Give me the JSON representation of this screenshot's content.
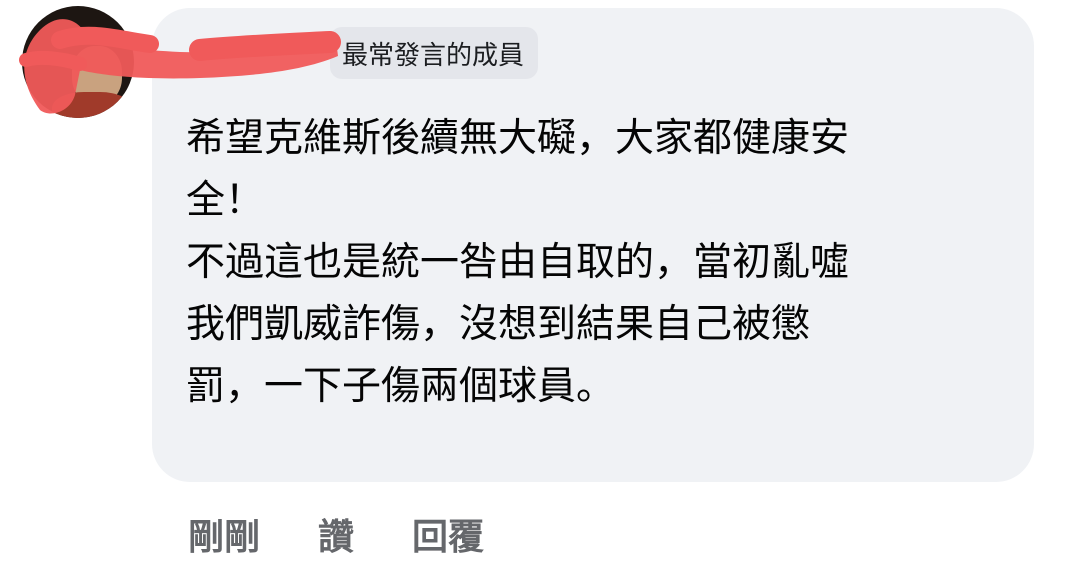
{
  "comment": {
    "author_badge": "最常發言的成員",
    "body_lines": [
      "希望克維斯後續無大礙，大家都健康安",
      "全！",
      "不過這也是統一咎由自取的，當初亂噓",
      "我們凱威詐傷，沒想到結果自己被懲",
      "罰，一下子傷兩個球員。"
    ]
  },
  "actions": {
    "timestamp": "剛剛",
    "like_label": "讚",
    "reply_label": "回覆"
  },
  "colors": {
    "bubble_bg": "#f0f2f5",
    "badge_bg": "#e4e6eb",
    "action_text": "#65676b",
    "redaction": "#f05a5a"
  },
  "icons": {
    "avatar": "profile-photo"
  }
}
